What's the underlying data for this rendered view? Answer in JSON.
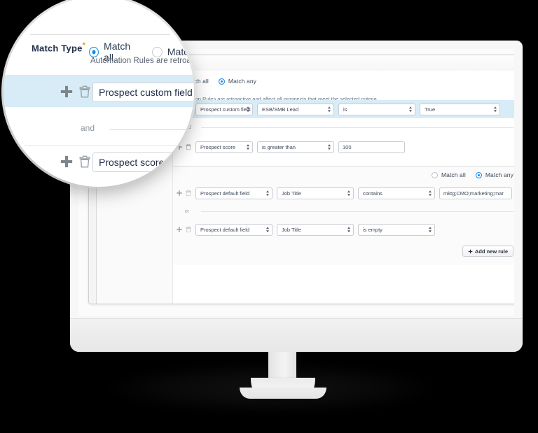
{
  "device": {
    "type": "desktop-monitor"
  },
  "window": {
    "title": ""
  },
  "form": {
    "match_type": {
      "label": "Match Type",
      "required_marker": "*",
      "options": [
        {
          "label": "Match all",
          "selected": true
        },
        {
          "label": "Match any",
          "selected": false
        }
      ],
      "helper": "Automation Rules are retroactive and affect all prospects that meet the selected criteria.",
      "helper_truncated": "Automation Rules are retroa"
    },
    "rules": [
      {
        "highlighted": true,
        "field_type": "Prospect custom field",
        "field_type_truncated": "m field",
        "field_name": "ESB/SMB Lead",
        "operator": "is",
        "value": "True",
        "value_kind": "select"
      },
      {
        "highlighted": false,
        "field_type": "Prospect score",
        "field_type_truncated": "score",
        "operator": "is greater than",
        "value": "100",
        "value_kind": "text"
      }
    ],
    "conjunction_outer": "and",
    "nested_group": {
      "match_options": [
        {
          "label": "Match all",
          "selected": false
        },
        {
          "label": "Match any",
          "selected": true
        }
      ],
      "rules": [
        {
          "field_type": "Prospect default field",
          "field_name": "Job Title",
          "operator": "contains",
          "value": "mktg;CMO;marketing;mar",
          "value_kind": "text"
        },
        {
          "field_type": "Prospect default field",
          "field_name": "Job Title",
          "operator": "is empty",
          "value": "",
          "value_kind": "none"
        }
      ],
      "conjunction": "or"
    },
    "add_rule_button": {
      "icon": "plus-icon",
      "label": "Add new rule"
    },
    "row_icons": {
      "add": "plus-icon",
      "delete": "trash-icon"
    }
  },
  "magnifier": {
    "match_type_label": "Match Type",
    "required_marker": "*",
    "radio_all": "Match all",
    "radio_any": "Match",
    "helper": "Automation Rules are retroa",
    "field_one": "Prospect custom field",
    "conjunction": "and",
    "field_two": "Prospect score"
  },
  "colors": {
    "accent_blue": "#1589ee",
    "highlight_row": "#d7ecf7",
    "text_dark": "#22304a",
    "text_muted": "#6b7582",
    "border": "#c9ccd1",
    "screen_bg": "#ffffff",
    "monitor_body": "#f7f7f7",
    "backdrop": "#000000"
  }
}
